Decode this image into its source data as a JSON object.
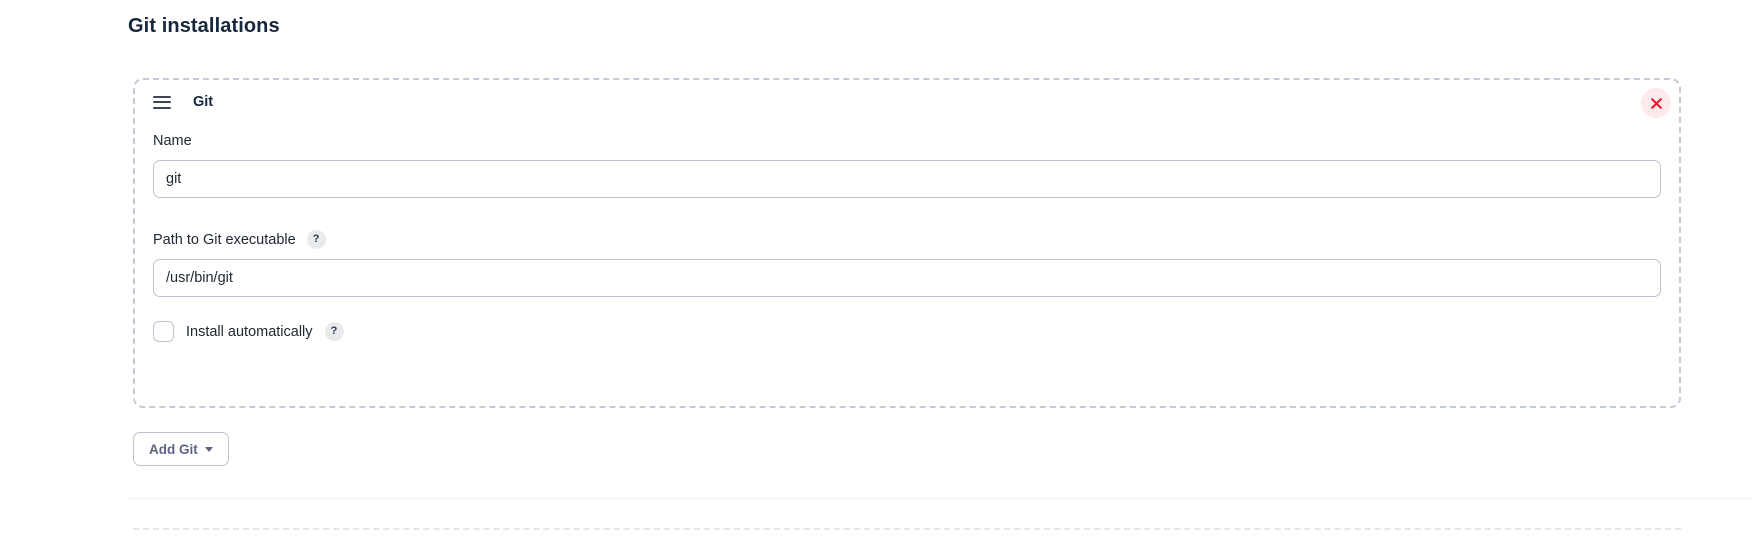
{
  "section": {
    "title": "Git installations"
  },
  "tool_card": {
    "drag_handle_icon": "drag-handle-icon",
    "title": "Git",
    "close_icon": "close-icon",
    "fields": {
      "name": {
        "label": "Name",
        "value": "git",
        "placeholder": ""
      },
      "path": {
        "label": "Path to Git executable",
        "help": "?",
        "value": "/usr/bin/git",
        "placeholder": ""
      },
      "install_automatically": {
        "label": "Install automatically",
        "help": "?",
        "checked": false
      }
    }
  },
  "actions": {
    "add_label": "Add Git",
    "caret_icon": "chevron-down-icon"
  },
  "colors": {
    "heading": "#16263d",
    "dashed_border": "#c3ccd5",
    "input_border": "#b9c4ce",
    "close_bg": "#fdeaec",
    "close_mark": "#e8192c",
    "button_text": "#5d6483",
    "help_badge_bg": "#e8eaec"
  }
}
